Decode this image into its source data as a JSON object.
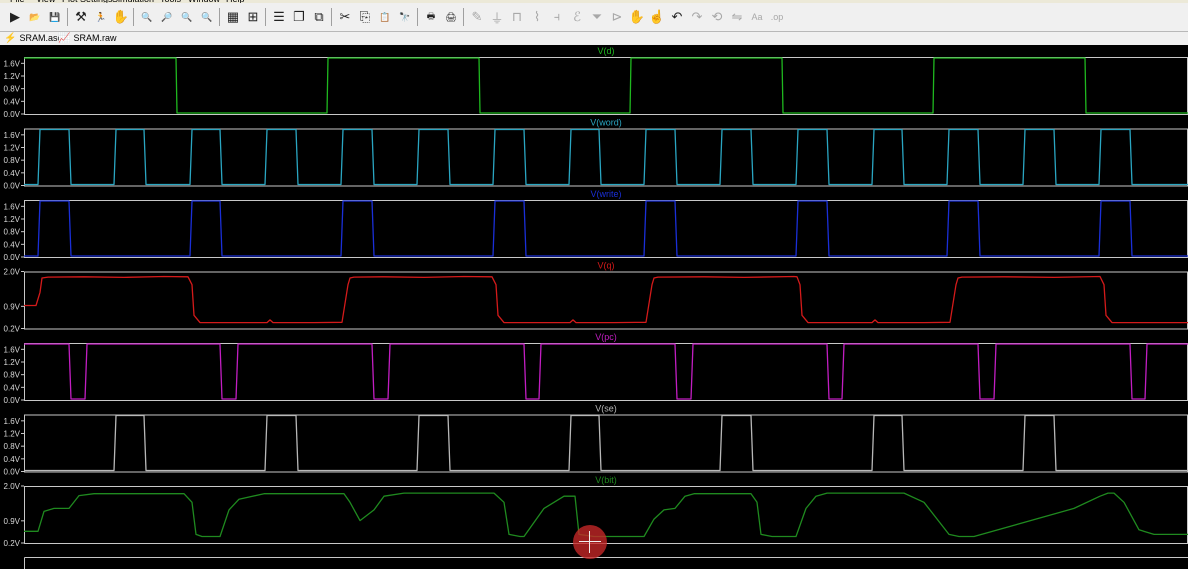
{
  "menu": {
    "items": [
      "File",
      "View",
      "Plot Settings",
      "Simulation",
      "Tools",
      "Window",
      "Help"
    ]
  },
  "toolbar": {
    "buttons": [
      {
        "name": "run-button",
        "icon": "run-icon",
        "glyph": "▶",
        "enabled": true
      },
      {
        "name": "open-button",
        "icon": "folder-open-icon",
        "glyph": "📂",
        "enabled": true
      },
      {
        "name": "save-button",
        "icon": "floppy-icon",
        "glyph": "💾",
        "enabled": true
      },
      {
        "name": "control-panel-button",
        "icon": "hammer-icon",
        "glyph": "⚒",
        "enabled": true
      },
      {
        "name": "halt-button",
        "icon": "running-man-icon",
        "glyph": "🏃",
        "enabled": true
      },
      {
        "name": "pan-button",
        "icon": "hand-icon",
        "glyph": "✋",
        "enabled": false
      },
      {
        "name": "zoom-in-button",
        "icon": "zoom-in-icon",
        "glyph": "🔍",
        "enabled": true
      },
      {
        "name": "zoom-area-button",
        "icon": "zoom-area-icon",
        "glyph": "🔎",
        "enabled": true
      },
      {
        "name": "zoom-out-button",
        "icon": "zoom-out-icon",
        "glyph": "🔍",
        "enabled": true
      },
      {
        "name": "zoom-fit-button",
        "icon": "zoom-fit-icon",
        "glyph": "🔍",
        "enabled": true
      },
      {
        "name": "autorange-button",
        "icon": "autorange-icon",
        "glyph": "▦",
        "enabled": true
      },
      {
        "name": "add-trace-button",
        "icon": "add-trace-icon",
        "glyph": "⊞",
        "enabled": true
      },
      {
        "name": "tile-horizontal-button",
        "icon": "tile-horizontal-icon",
        "glyph": "☰",
        "enabled": true
      },
      {
        "name": "cascade-button",
        "icon": "cascade-icon",
        "glyph": "❐",
        "enabled": true
      },
      {
        "name": "tile-vertical-button",
        "icon": "tile-vertical-icon",
        "glyph": "⧉",
        "enabled": true
      },
      {
        "name": "cut-button",
        "icon": "scissors-icon",
        "glyph": "✂",
        "enabled": true
      },
      {
        "name": "copy-button",
        "icon": "copy-icon",
        "glyph": "⎘",
        "enabled": true
      },
      {
        "name": "paste-button",
        "icon": "paste-icon",
        "glyph": "📋",
        "enabled": true
      },
      {
        "name": "find-button",
        "icon": "binoculars-icon",
        "glyph": "🔭",
        "enabled": true
      },
      {
        "name": "print-button",
        "icon": "printer-icon",
        "glyph": "🖶",
        "enabled": true
      },
      {
        "name": "print-setup-button",
        "icon": "print-setup-icon",
        "glyph": "🖨",
        "enabled": true
      },
      {
        "name": "draw-wire-button",
        "icon": "pencil-icon",
        "glyph": "✎",
        "enabled": false
      },
      {
        "name": "ground-button",
        "icon": "ground-icon",
        "glyph": "⏚",
        "enabled": false
      },
      {
        "name": "label-net-button",
        "icon": "label-net-icon",
        "glyph": "⊓",
        "enabled": false
      },
      {
        "name": "resistor-button",
        "icon": "resistor-icon",
        "glyph": "⌇",
        "enabled": false
      },
      {
        "name": "capacitor-button",
        "icon": "capacitor-icon",
        "glyph": "⫞",
        "enabled": false
      },
      {
        "name": "inductor-button",
        "icon": "inductor-icon",
        "glyph": "ℰ",
        "enabled": false
      },
      {
        "name": "diode-button",
        "icon": "diode-icon",
        "glyph": "⏷",
        "enabled": false
      },
      {
        "name": "component-button",
        "icon": "component-icon",
        "glyph": "⊳",
        "enabled": false
      },
      {
        "name": "move-button",
        "icon": "move-hand-icon",
        "glyph": "✋",
        "enabled": false
      },
      {
        "name": "drag-button",
        "icon": "drag-hand-icon",
        "glyph": "☝",
        "enabled": false
      },
      {
        "name": "undo-button",
        "icon": "undo-icon",
        "glyph": "↶",
        "enabled": true
      },
      {
        "name": "redo-button",
        "icon": "redo-icon",
        "glyph": "↷",
        "enabled": false
      },
      {
        "name": "rotate-button",
        "icon": "rotate-icon",
        "glyph": "⟲",
        "enabled": false
      },
      {
        "name": "mirror-button",
        "icon": "mirror-icon",
        "glyph": "⇋",
        "enabled": false
      },
      {
        "name": "text-button",
        "icon": "text-icon",
        "glyph": "Aa",
        "enabled": false
      },
      {
        "name": "spice-directive-button",
        "icon": "spice-directive-icon",
        "glyph": ".op",
        "enabled": false
      }
    ]
  },
  "tabs": [
    {
      "label": "SRAM.asc",
      "icon": "schematic-icon",
      "glyph": "⚡"
    },
    {
      "label": "SRAM.raw",
      "icon": "waveform-icon",
      "glyph": "📈"
    }
  ],
  "colors": {
    "background": "#000000",
    "axis": "#c8c8c8",
    "axis_label": "#d8d8d8",
    "V(d)": "#1fb81f",
    "V(word)": "#2aa6c2",
    "V(write)": "#1a2fd8",
    "V(q)": "#d41a1a",
    "V(pc)": "#c21ec2",
    "V(se)": "#b8b8b8",
    "V(bit)": "#1f8a1f"
  },
  "chart_data": [
    {
      "type": "line",
      "title": "V(d)",
      "color": "#1fb81f",
      "ylim": [
        0,
        1.8
      ],
      "yticks": [
        "1.6V",
        "1.2V",
        "0.8V",
        "0.4V",
        "0.0V"
      ],
      "x": [
        0,
        152,
        153,
        303,
        304,
        455,
        456,
        606,
        607,
        758,
        759,
        909,
        910,
        1061,
        1062,
        1164
      ],
      "y": [
        1.8,
        1.8,
        0,
        0,
        1.8,
        1.8,
        0,
        0,
        1.8,
        1.8,
        0,
        0,
        1.8,
        1.8,
        0,
        0
      ]
    },
    {
      "type": "line",
      "title": "V(word)",
      "color": "#2aa6c2",
      "ylim": [
        0,
        1.8
      ],
      "yticks": [
        "1.6V",
        "1.2V",
        "0.8V",
        "0.4V",
        "0.0V"
      ],
      "x": [
        0,
        14,
        16,
        45,
        47,
        90,
        92,
        120,
        122,
        166,
        168,
        196,
        198,
        241,
        243,
        272,
        274,
        317,
        319,
        348,
        350,
        393,
        395,
        424,
        426,
        469,
        471,
        500,
        502,
        545,
        547,
        575,
        577,
        620,
        622,
        651,
        653,
        696,
        698,
        727,
        729,
        772,
        774,
        803,
        805,
        848,
        850,
        878,
        880,
        923,
        925,
        954,
        956,
        999,
        1001,
        1030,
        1032,
        1075,
        1077,
        1106,
        1108,
        1164
      ],
      "y": [
        0,
        0,
        1.8,
        1.8,
        0,
        0,
        1.8,
        1.8,
        0,
        0,
        1.8,
        1.8,
        0,
        0,
        1.8,
        1.8,
        0,
        0,
        1.8,
        1.8,
        0,
        0,
        1.8,
        1.8,
        0,
        0,
        1.8,
        1.8,
        0,
        0,
        1.8,
        1.8,
        0,
        0,
        1.8,
        1.8,
        0,
        0,
        1.8,
        1.8,
        0,
        0,
        1.8,
        1.8,
        0,
        0,
        1.8,
        1.8,
        0,
        0,
        1.8,
        1.8,
        0,
        0,
        1.8,
        1.8,
        0,
        0,
        1.8,
        1.8,
        0,
        0
      ]
    },
    {
      "type": "line",
      "title": "V(write)",
      "color": "#1a2fd8",
      "ylim": [
        0,
        1.8
      ],
      "yticks": [
        "1.6V",
        "1.2V",
        "0.8V",
        "0.4V",
        "0.0V"
      ],
      "x": [
        0,
        14,
        16,
        45,
        47,
        166,
        168,
        196,
        198,
        317,
        319,
        348,
        350,
        469,
        471,
        500,
        502,
        620,
        622,
        651,
        653,
        772,
        774,
        803,
        805,
        923,
        925,
        954,
        956,
        1075,
        1077,
        1106,
        1108,
        1164
      ],
      "y": [
        0,
        0,
        1.8,
        1.8,
        0,
        0,
        1.8,
        1.8,
        0,
        0,
        1.8,
        1.8,
        0,
        0,
        1.8,
        1.8,
        0,
        0,
        1.8,
        1.8,
        0,
        0,
        1.8,
        1.8,
        0,
        0,
        1.8,
        1.8,
        0,
        0,
        1.8,
        1.8,
        0,
        0
      ]
    },
    {
      "type": "line",
      "title": "V(q)",
      "color": "#d41a1a",
      "ylim": [
        0.2,
        2.0
      ],
      "yticks": [
        "2.0V",
        "0.9V",
        "0.2V"
      ],
      "x": [
        0,
        12,
        16,
        18,
        24,
        60,
        100,
        140,
        164,
        168,
        170,
        176,
        210,
        243,
        246,
        249,
        290,
        318,
        324,
        326,
        330,
        360,
        400,
        440,
        468,
        472,
        474,
        480,
        520,
        546,
        549,
        552,
        590,
        622,
        628,
        630,
        634,
        680,
        720,
        770,
        773,
        776,
        778,
        784,
        820,
        848,
        851,
        854,
        900,
        926,
        932,
        934,
        938,
        980,
        1030,
        1076,
        1080,
        1082,
        1088,
        1130,
        1164
      ],
      "y": [
        0.92,
        0.92,
        1.35,
        1.82,
        1.85,
        1.86,
        1.84,
        1.87,
        1.86,
        1.6,
        0.6,
        0.36,
        0.36,
        0.36,
        0.45,
        0.36,
        0.36,
        0.37,
        1.6,
        1.82,
        1.85,
        1.86,
        1.84,
        1.87,
        1.86,
        1.6,
        0.6,
        0.36,
        0.36,
        0.36,
        0.45,
        0.36,
        0.36,
        0.37,
        1.6,
        1.82,
        1.85,
        1.86,
        1.84,
        1.87,
        1.86,
        1.6,
        0.6,
        0.36,
        0.36,
        0.36,
        0.45,
        0.36,
        0.36,
        0.37,
        1.6,
        1.82,
        1.85,
        1.86,
        1.84,
        1.87,
        1.6,
        0.6,
        0.36,
        0.36,
        0.36
      ]
    },
    {
      "type": "line",
      "title": "V(pc)",
      "color": "#c21ec2",
      "ylim": [
        0,
        1.8
      ],
      "yticks": [
        "1.6V",
        "1.2V",
        "0.8V",
        "0.4V",
        "0.0V"
      ],
      "x": [
        0,
        45,
        47,
        61,
        63,
        196,
        198,
        212,
        214,
        348,
        350,
        364,
        366,
        500,
        502,
        515,
        517,
        651,
        653,
        667,
        669,
        803,
        805,
        818,
        820,
        954,
        956,
        970,
        972,
        1106,
        1108,
        1121,
        1123,
        1164
      ],
      "y": [
        1.8,
        1.8,
        0,
        0,
        1.8,
        1.8,
        0,
        0,
        1.8,
        1.8,
        0,
        0,
        1.8,
        1.8,
        0,
        0,
        1.8,
        1.8,
        0,
        0,
        1.8,
        1.8,
        0,
        0,
        1.8,
        1.8,
        0,
        0,
        1.8,
        1.8,
        0,
        0,
        1.8,
        1.8
      ]
    },
    {
      "type": "line",
      "title": "V(se)",
      "color": "#b8b8b8",
      "ylim": [
        0,
        1.8
      ],
      "yticks": [
        "1.6V",
        "1.2V",
        "0.8V",
        "0.4V",
        "0.0V"
      ],
      "x": [
        0,
        90,
        92,
        120,
        122,
        241,
        243,
        272,
        274,
        393,
        395,
        424,
        426,
        545,
        547,
        575,
        577,
        696,
        698,
        727,
        729,
        848,
        850,
        878,
        880,
        999,
        1001,
        1030,
        1032,
        1164
      ],
      "y": [
        0,
        0,
        1.8,
        1.8,
        0,
        0,
        1.8,
        1.8,
        0,
        0,
        1.8,
        1.8,
        0,
        0,
        1.8,
        1.8,
        0,
        0,
        1.8,
        1.8,
        0,
        0,
        1.8,
        1.8,
        0,
        0,
        1.8,
        1.8,
        0,
        0
      ]
    },
    {
      "type": "line",
      "title": "V(bit)",
      "color": "#1f8a1f",
      "ylim": [
        0.2,
        2.0
      ],
      "yticks": [
        "2.0V",
        "0.9V",
        "0.2V"
      ],
      "x": [
        0,
        14,
        20,
        30,
        45,
        55,
        70,
        160,
        168,
        172,
        178,
        196,
        205,
        215,
        240,
        320,
        326,
        336,
        350,
        360,
        380,
        470,
        480,
        485,
        496,
        500,
        520,
        540,
        551,
        555,
        570,
        620,
        630,
        640,
        651,
        661,
        670,
        696,
        727,
        733,
        737,
        748,
        772,
        782,
        792,
        803,
        880,
        900,
        925,
        935,
        950,
        1050,
        1076,
        1084,
        1090,
        1100,
        1115,
        1130,
        1164
      ],
      "y": [
        0.55,
        0.55,
        1.2,
        1.3,
        1.3,
        1.72,
        1.78,
        1.78,
        1.5,
        0.45,
        0.38,
        0.38,
        1.25,
        1.6,
        1.78,
        1.78,
        1.5,
        0.9,
        1.25,
        1.7,
        1.8,
        1.8,
        1.5,
        0.45,
        0.38,
        0.38,
        1.3,
        1.7,
        1.7,
        0.45,
        0.38,
        0.38,
        0.95,
        1.25,
        1.3,
        1.7,
        1.78,
        1.78,
        1.78,
        1.5,
        0.45,
        0.38,
        0.38,
        1.3,
        1.7,
        1.8,
        1.8,
        1.5,
        0.45,
        0.38,
        0.38,
        1.3,
        1.7,
        1.8,
        1.8,
        1.5,
        0.6,
        0.45,
        0.45
      ]
    }
  ]
}
